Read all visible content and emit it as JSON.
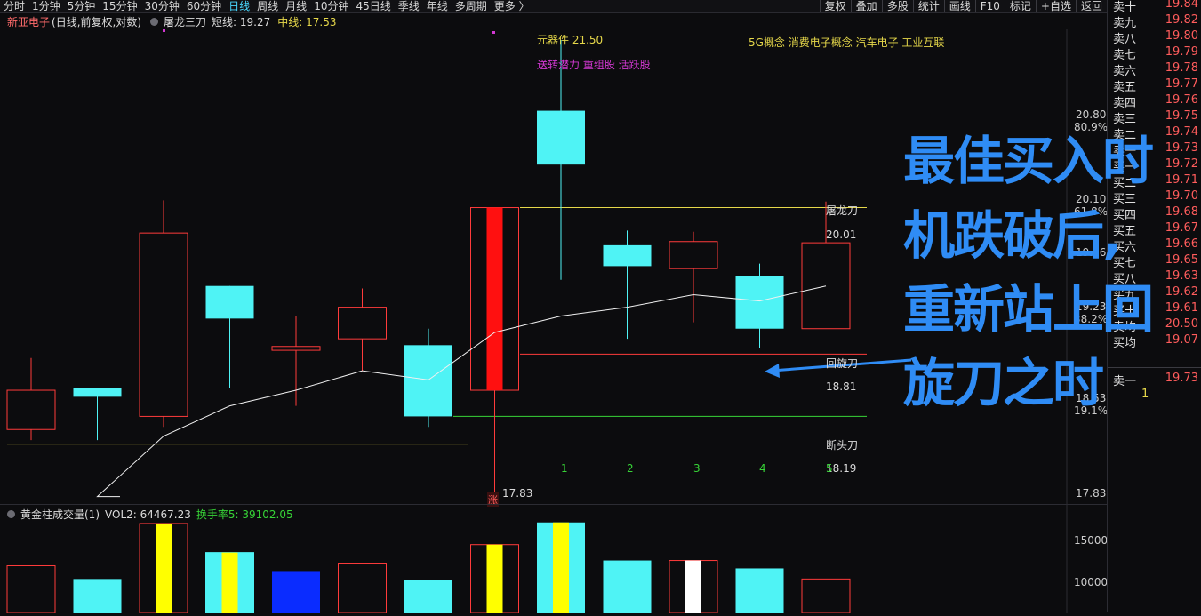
{
  "toolbar": {
    "periods": [
      "分时",
      "1分钟",
      "5分钟",
      "15分钟",
      "30分钟",
      "60分钟",
      "日线",
      "周线",
      "月线",
      "10分钟",
      "45日线",
      "季线",
      "年线",
      "多周期",
      "更多 〉"
    ],
    "active_period": "日线",
    "right_buttons": [
      "复权",
      "叠加",
      "多股",
      "统计",
      "画线",
      "F10",
      "标记",
      "+自选",
      "返回"
    ]
  },
  "chart_title": {
    "stock_name": "新亚电子",
    "mode": "(日线,前复权,对数)",
    "indicator": "屠龙三刀",
    "short_line": "短线: 19.27",
    "mid_line": "中线: 17.53"
  },
  "annotations": {
    "component_label": "元器件 21.50",
    "tags_purple": "送转潜力 重组股 活跃股",
    "concepts": "5G概念 消费电子概念 汽车电子 工业互联",
    "tulong_dao": "屠龙刀",
    "huixuan_dao": "回旋刀",
    "duantou_dao": "断头刀",
    "price_2001": "20.01",
    "price_1881": "18.81",
    "price_1819": "18.19",
    "low_price": "17.83",
    "zhang_marker": "涨",
    "count_labels": [
      "1",
      "2",
      "3",
      "4",
      "5"
    ]
  },
  "axis_right": {
    "labels": [
      "20.80",
      "80.9%",
      "20.10",
      "61.8%",
      "19.66",
      "19.23",
      "38.2%",
      "18.53",
      "19.1%",
      "17.83"
    ]
  },
  "volume": {
    "title": "黄金柱成交量(1)",
    "vol2": "VOL2: 64467.23",
    "turnover": "换手率5: 39102.05",
    "axis": [
      "15000",
      "10000"
    ]
  },
  "order_book": {
    "rows": [
      {
        "label": "卖十",
        "price": "19.84"
      },
      {
        "label": "卖九",
        "price": "19.82"
      },
      {
        "label": "卖八",
        "price": "19.80"
      },
      {
        "label": "卖七",
        "price": "19.79"
      },
      {
        "label": "卖六",
        "price": "19.78"
      },
      {
        "label": "卖五",
        "price": "19.77"
      },
      {
        "label": "卖四",
        "price": "19.76"
      },
      {
        "label": "卖三",
        "price": "19.75"
      },
      {
        "label": "卖二",
        "price": "19.74"
      },
      {
        "label": "卖一",
        "price": "19.73"
      },
      {
        "label": "买一",
        "price": "19.72"
      },
      {
        "label": "买二",
        "price": "19.71"
      },
      {
        "label": "买三",
        "price": "19.70"
      },
      {
        "label": "买四",
        "price": "19.68"
      },
      {
        "label": "买五",
        "price": "19.67"
      },
      {
        "label": "买六",
        "price": "19.66"
      },
      {
        "label": "买七",
        "price": "19.65"
      },
      {
        "label": "买八",
        "price": "19.63"
      },
      {
        "label": "买九",
        "price": "19.62"
      },
      {
        "label": "买十",
        "price": "19.61"
      },
      {
        "label": "卖均",
        "price": "20.50"
      },
      {
        "label": "买均",
        "price": "19.07"
      }
    ],
    "bottom_label": "卖一",
    "bottom_price": "19.73",
    "bottom_qty": "1"
  },
  "overlay": {
    "line1": "最佳买入时",
    "line2": "机跌破后,",
    "line3": "重新站上回",
    "line4": "旋刀之时"
  },
  "colors": {
    "up": "#ff3b3b",
    "down": "#4ff3f5",
    "accent": "#2f8cf5",
    "yellow": "#e6d84a",
    "purple": "#d238d2"
  },
  "chart_data": {
    "type": "candlestick",
    "candles": [
      {
        "open": 18.6,
        "high": 18.85,
        "low": 18.22,
        "close": 18.3,
        "dir": "up"
      },
      {
        "open": 18.62,
        "high": 18.62,
        "low": 18.22,
        "close": 18.55,
        "dir": "down"
      },
      {
        "open": 18.4,
        "high": 20.12,
        "low": 18.32,
        "close": 19.85,
        "dir": "up"
      },
      {
        "open": 19.42,
        "high": 19.42,
        "low": 18.62,
        "close": 19.16,
        "dir": "down"
      },
      {
        "open": 18.91,
        "high": 19.18,
        "low": 18.48,
        "close": 18.94,
        "dir": "up"
      },
      {
        "open": 19.0,
        "high": 19.4,
        "low": 18.75,
        "close": 19.25,
        "dir": "up"
      },
      {
        "open": 18.95,
        "high": 19.08,
        "low": 18.32,
        "close": 18.4,
        "dir": "down"
      },
      {
        "open": 18.6,
        "high": 20.06,
        "low": 17.83,
        "close": 20.06,
        "dir": "up-filled"
      },
      {
        "open": 20.88,
        "high": 21.5,
        "low": 19.47,
        "close": 20.42,
        "dir": "down"
      },
      {
        "open": 19.75,
        "high": 19.87,
        "low": 19.0,
        "close": 19.58,
        "dir": "down"
      },
      {
        "open": 19.56,
        "high": 19.86,
        "low": 19.13,
        "close": 19.78,
        "dir": "up"
      },
      {
        "open": 19.5,
        "high": 19.6,
        "low": 18.93,
        "close": 19.08,
        "dir": "down"
      },
      {
        "open": 19.08,
        "high": 20.11,
        "low": 19.08,
        "close": 19.77,
        "dir": "up"
      }
    ],
    "ma_line": [
      null,
      17.8,
      18.25,
      18.48,
      18.6,
      18.75,
      18.68,
      19.05,
      19.18,
      19.25,
      19.35,
      19.3,
      19.42
    ],
    "volume": [
      {
        "v": 9000,
        "kind": "up"
      },
      {
        "v": 6500,
        "kind": "down"
      },
      {
        "v": 17000,
        "kind": "gold"
      },
      {
        "v": 11500,
        "kind": "gold"
      },
      {
        "v": 8000,
        "kind": "blue"
      },
      {
        "v": 9500,
        "kind": "up"
      },
      {
        "v": 6300,
        "kind": "down"
      },
      {
        "v": 13000,
        "kind": "gold"
      },
      {
        "v": 17200,
        "kind": "gold-cyan"
      },
      {
        "v": 10000,
        "kind": "down"
      },
      {
        "v": 10000,
        "kind": "white"
      },
      {
        "v": 8500,
        "kind": "down"
      },
      {
        "v": 6500,
        "kind": "up"
      }
    ]
  }
}
